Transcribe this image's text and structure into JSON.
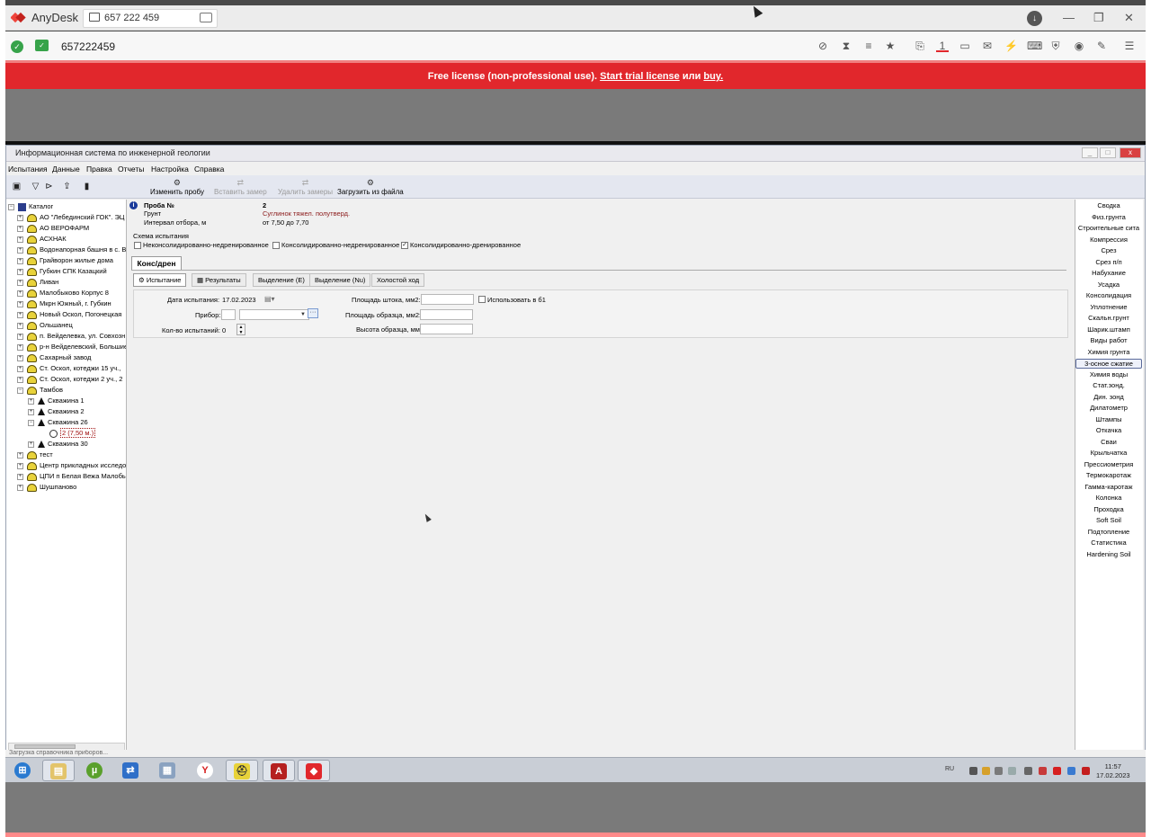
{
  "anydesk": {
    "app_name": "AnyDesk",
    "tab_address": "657 222 459",
    "address": "657222459",
    "banner_prefix": "Free license (non-professional use).",
    "banner_trial": "Start trial license",
    "banner_or": "или",
    "banner_buy": "buy."
  },
  "app": {
    "title": "Информационная система по инженерной геологии",
    "menu": [
      "Испытания",
      "Данные",
      "Правка",
      "Отчеты",
      "Настройка",
      "Справка"
    ],
    "toolbar": {
      "edit_sample": "Изменить пробу",
      "insert_measure": "Вставить замер",
      "delete_measures": "Удалить замеры",
      "load_from_file": "Загрузить из файла"
    }
  },
  "tree": {
    "root": "Каталог",
    "items": [
      "АО \"Лебединский ГОК\". ЭЦ",
      "АО ВЕРОФАРМ",
      "АСХНАК",
      "Водонапорная башня в с. Ве",
      "Грайворон жилые дома",
      "Губкин СПК Казацкий",
      "Ливан",
      "Малобыково Корпус 8",
      "Мкрн Южный, г. Губкин",
      "Новый Оскол, Погонецкая",
      "Ольшанец",
      "п. Вейделевка, ул. Совхозн",
      "р-н Вейделевский, Большие",
      "Сахарный завод",
      "Ст. Оскол, котеджи 15 уч.,",
      "Ст. Оскол, котеджи 2 уч., 2",
      "Тамбов"
    ],
    "tambov_children": [
      "Скважина 1",
      "Скважина 2",
      "Скважина 26"
    ],
    "sample": "2 (7,50 м.)",
    "well30": "Скважина 30",
    "after": [
      "тест",
      "Центр прикладных исследо",
      "ЦПИ п Белая Вежа Малобык",
      "Шушпаново"
    ]
  },
  "sample_info": {
    "probe_label": "Проба №",
    "probe_value": "2",
    "soil_label": "Грунт",
    "soil_value": "Суглинок тяжел. полутверд.",
    "interval_label": "Интервал отбора, м",
    "interval_value": "от  7,50 до  7,70"
  },
  "scheme": {
    "label": "Схема испытания",
    "options": [
      {
        "label": "Неконсолидированно-недренированное",
        "checked": false
      },
      {
        "label": "Консолидированно-недренированное",
        "checked": false
      },
      {
        "label": "Консолидированно-дренированное",
        "checked": true
      }
    ]
  },
  "main_tab": "Конс/дрен",
  "subtabs": [
    "Испытание",
    "Результаты",
    "Выделение (E)",
    "Выделение (Nu)",
    "Холостой ход"
  ],
  "form": {
    "date_label": "Дата испытания:",
    "date_value": "17.02.2023",
    "device_label": "Прибор:",
    "count_label": "Кол-во испытаний:",
    "count_value": "0",
    "rod_area_label": "Площадь штока, мм2:",
    "use_label": "Использовать в б1",
    "sample_area_label": "Площадь образца, мм2:",
    "sample_height_label": "Высота образца, мм:"
  },
  "right_panel": [
    "Сводка",
    "Физ.грунта",
    "Строительные сита",
    "Компрессия",
    "Срез",
    "Срез п/п",
    "Набухание",
    "Усадка",
    "Консолидация",
    "Уплотнение",
    "Скальн.грунт",
    "Шарик.штамп",
    "Виды работ",
    "Химия грунта",
    "3-осное сжатие",
    "Химия воды",
    "Стат.зонд.",
    "Дин. зонд",
    "Дилатометр",
    "Штампы",
    "Откачка",
    "Сваи",
    "Крыльчатка",
    "Прессиометрия",
    "Термокаротаж",
    "Гамма-каротаж",
    "Колонка",
    "Проходка",
    "Soft Soil",
    "Подтопление",
    "Статистика",
    "Hardening Soil"
  ],
  "right_panel_active": "3-осное сжатие",
  "status": "Загрузка справочника приборов...",
  "taskbar": {
    "lang": "RU",
    "time": "11:57",
    "date": "17.02.2023"
  },
  "colors": {
    "brand": "#e1272c",
    "ok": "#37a34a"
  }
}
